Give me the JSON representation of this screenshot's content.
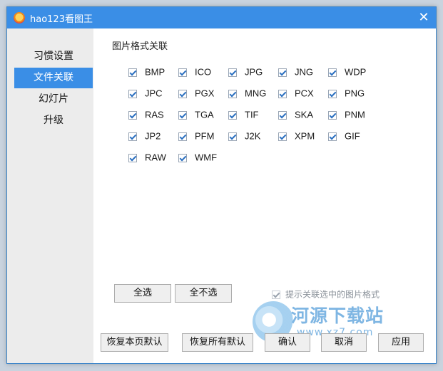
{
  "window": {
    "title": "hao123看图王",
    "close_icon": "close-icon",
    "app_icon": "app-logo-icon"
  },
  "sidebar": {
    "items": [
      {
        "label": "习惯设置",
        "active": false
      },
      {
        "label": "文件关联",
        "active": true
      },
      {
        "label": "幻灯片",
        "active": false
      },
      {
        "label": "升级",
        "active": false
      }
    ]
  },
  "main": {
    "section_label": "图片格式关联",
    "formats": [
      {
        "label": "BMP",
        "checked": true
      },
      {
        "label": "ICO",
        "checked": true
      },
      {
        "label": "JPG",
        "checked": true
      },
      {
        "label": "JNG",
        "checked": true
      },
      {
        "label": "WDP",
        "checked": true
      },
      {
        "label": "JPC",
        "checked": true
      },
      {
        "label": "PGX",
        "checked": true
      },
      {
        "label": "MNG",
        "checked": true
      },
      {
        "label": "PCX",
        "checked": true
      },
      {
        "label": "PNG",
        "checked": true
      },
      {
        "label": "RAS",
        "checked": true
      },
      {
        "label": "TGA",
        "checked": true
      },
      {
        "label": "TIF",
        "checked": true
      },
      {
        "label": "SKA",
        "checked": true
      },
      {
        "label": "PNM",
        "checked": true
      },
      {
        "label": "JP2",
        "checked": true
      },
      {
        "label": "PFM",
        "checked": true
      },
      {
        "label": "J2K",
        "checked": true
      },
      {
        "label": "XPM",
        "checked": true
      },
      {
        "label": "GIF",
        "checked": true
      },
      {
        "label": "RAW",
        "checked": true
      },
      {
        "label": "WMF",
        "checked": true
      }
    ],
    "select_all_label": "全选",
    "select_none_label": "全不选",
    "hint": {
      "label": "提示关联选中的图片格式",
      "checked": true,
      "disabled": true
    }
  },
  "footer": {
    "restore_page_label": "恢复本页默认",
    "restore_all_label": "恢复所有默认",
    "ok_label": "确认",
    "cancel_label": "取消",
    "apply_label": "应用"
  },
  "watermark": {
    "title": "河源下载站",
    "url": "www.xz7.com"
  }
}
